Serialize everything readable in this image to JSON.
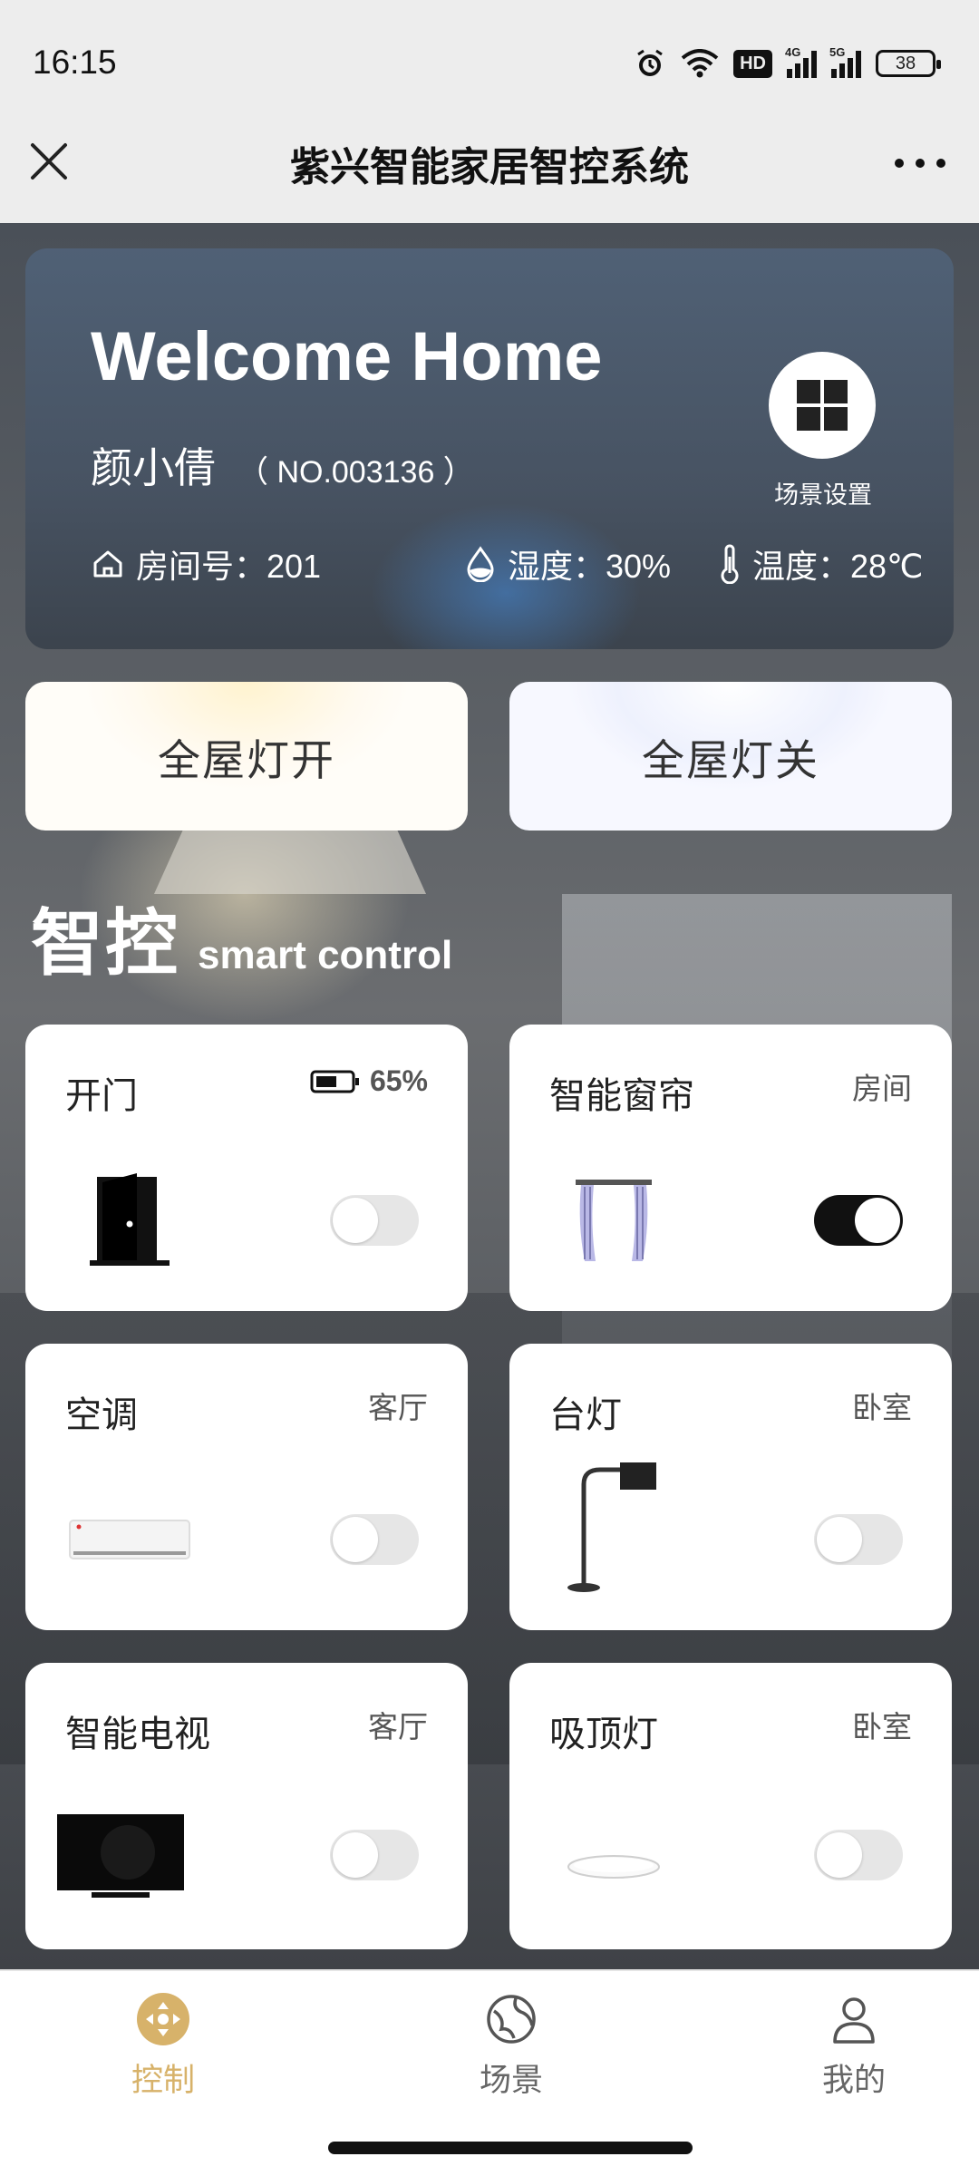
{
  "status_bar": {
    "time": "16:15",
    "hd_label": "HD",
    "net1_label": "4G",
    "net2_label": "5G",
    "battery_level": "38"
  },
  "title_bar": {
    "title": "紫兴智能家居智控系统"
  },
  "welcome": {
    "title": "Welcome Home",
    "user_name": "颜小倩",
    "user_no": "（ NO.003136 ）",
    "room": "房间号：201",
    "humidity": "湿度：30%",
    "temperature": "温度：28℃",
    "scene_settings_label": "场景设置"
  },
  "whole_house": {
    "on_label": "全屋灯开",
    "off_label": "全屋灯关"
  },
  "section": {
    "title_cn": "智控",
    "title_en": "smart control"
  },
  "devices": [
    {
      "name": "开门",
      "battery": "65%",
      "icon": "door-icon",
      "on": false
    },
    {
      "name": "智能窗帘",
      "location": "房间",
      "icon": "curtain-icon",
      "on": true
    },
    {
      "name": "空调",
      "location": "客厅",
      "icon": "air-conditioner-icon",
      "on": false
    },
    {
      "name": "台灯",
      "location": "卧室",
      "icon": "desk-lamp-icon",
      "on": false
    },
    {
      "name": "智能电视",
      "location": "客厅",
      "icon": "tv-icon",
      "on": false
    },
    {
      "name": "吸顶灯",
      "location": "卧室",
      "icon": "ceiling-light-icon",
      "on": false
    }
  ],
  "bottom_nav": {
    "items": [
      {
        "label": "控制",
        "icon": "control-icon",
        "active": true
      },
      {
        "label": "场景",
        "icon": "scene-icon",
        "active": false
      },
      {
        "label": "我的",
        "icon": "profile-icon",
        "active": false
      }
    ]
  },
  "colors": {
    "accent_gold": "#d7b26a",
    "toggle_on": "#111111",
    "toggle_off": "#e6e6e6"
  }
}
